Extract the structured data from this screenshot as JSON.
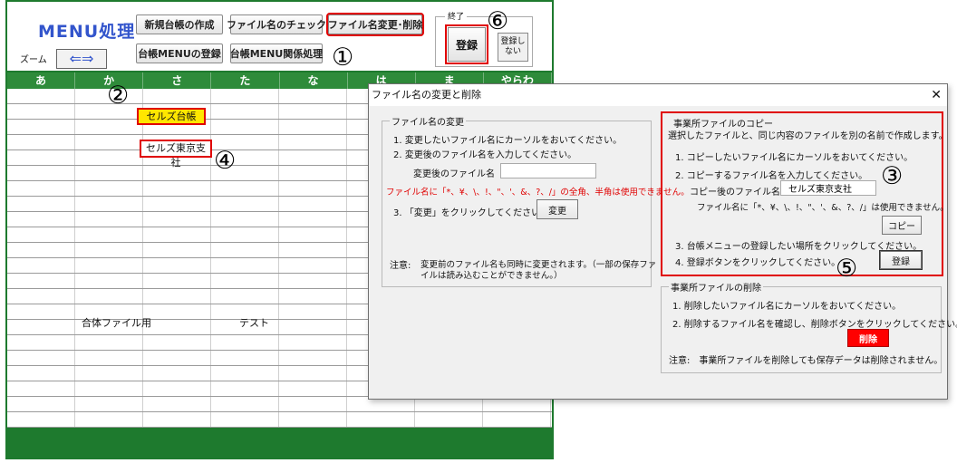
{
  "sheet": {
    "title": "MENU処理",
    "zoom_label": "ズーム",
    "zoom_arrows": "⇐⇒",
    "buttons": {
      "new_ledger": "新規台帳の作成",
      "file_check": "ファイル名のチェック",
      "rename_delete": "ファイル名変更･削除",
      "ledger_menu_register": "台帳MENUの登録",
      "ledger_menu_related": "台帳MENU関係処理"
    },
    "end_group": {
      "title": "終了",
      "register": "登録",
      "no_register": "登録しない"
    },
    "columns": [
      "あ",
      "か",
      "さ",
      "た",
      "な",
      "は",
      "ま",
      "やらわ"
    ],
    "cells": {
      "seruzu_ledger": "セルズ台帳",
      "seruzu_tokyo": "セルズ東京支社",
      "combined_file": "合体ファイル用",
      "test": "テスト"
    },
    "callouts": [
      "①",
      "②",
      "③",
      "④",
      "⑤",
      "⑥"
    ]
  },
  "dialog": {
    "title": "ファイル名の変更と削除",
    "close_glyph": "✕",
    "rename": {
      "title": "ファイル名の変更",
      "step1": "1. 変更したいファイル名にカーソルをおいてください。",
      "step2": "2. 変更後のファイル名を入力してください。",
      "new_name_label": "変更後のファイル名",
      "new_name_value": "",
      "warning": "ファイル名に「*、¥、\\、!、\"、'、&、?、/」の全角、半角は使用できません。",
      "step3": "3. 「変更」をクリックしてください。",
      "change_button": "変更",
      "note_label": "注意:",
      "note_line1": "変更前のファイル名も同時に変更されます。（一部の保存ファ",
      "note_line2": "イルは読み込むことができません。）"
    },
    "copy": {
      "title": "事業所ファイルのコピー",
      "desc": "選択したファイルと、同じ内容のファイルを別の名前で作成します。",
      "step1": "1. コピーしたいファイル名にカーソルをおいてください。",
      "step2": "2. コピーするファイル名を入力してください。",
      "after_name_label": "コピー後のファイル名",
      "after_name_value": "セルズ東京支社",
      "warning": "ファイル名に「*、¥、\\、!、\"、'、&、?、/」は使用できません。",
      "copy_button": "コピー",
      "step3": "3. 台帳メニューの登録したい場所をクリックしてください。",
      "step4": "4. 登録ボタンをクリックしてください。",
      "register_button": "登録"
    },
    "delete": {
      "title": "事業所ファイルの削除",
      "step1": "1. 削除したいファイル名にカーソルをおいてください。",
      "step2": "2. 削除するファイル名を確認し、削除ボタンをクリックしてください。",
      "delete_button": "削除",
      "note": "注意:　事業所ファイルを削除しても保存データは削除されません。"
    }
  },
  "colors": {
    "sheet_green": "#1e7a2e",
    "header_green": "#2e8b3a",
    "highlight_red": "#e00000",
    "title_blue": "#3355cc",
    "cell_yellow": "#ffe600"
  }
}
